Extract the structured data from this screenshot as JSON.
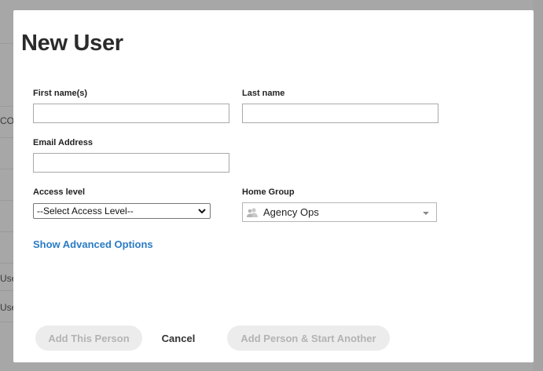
{
  "background": {
    "snippets": [
      "CO",
      "Use",
      "Use"
    ]
  },
  "modal": {
    "title": "New User",
    "first_name": {
      "label": "First name(s)",
      "value": "",
      "placeholder": ""
    },
    "last_name": {
      "label": "Last name",
      "value": "",
      "placeholder": ""
    },
    "email": {
      "label": "Email Address",
      "value": "",
      "placeholder": ""
    },
    "access_level": {
      "label": "Access level",
      "selected": "--Select Access Level--"
    },
    "home_group": {
      "label": "Home Group",
      "selected": "Agency Ops",
      "icon": "group-icon"
    },
    "advanced_link": "Show Advanced Options",
    "buttons": {
      "add": "Add This Person",
      "cancel": "Cancel",
      "add_another": "Add Person & Start Another"
    }
  },
  "colors": {
    "overlay": "#a7a7a7",
    "link": "#2a7bc4",
    "disabled_button_bg": "#ececec",
    "disabled_button_text": "#b3b3b3"
  }
}
